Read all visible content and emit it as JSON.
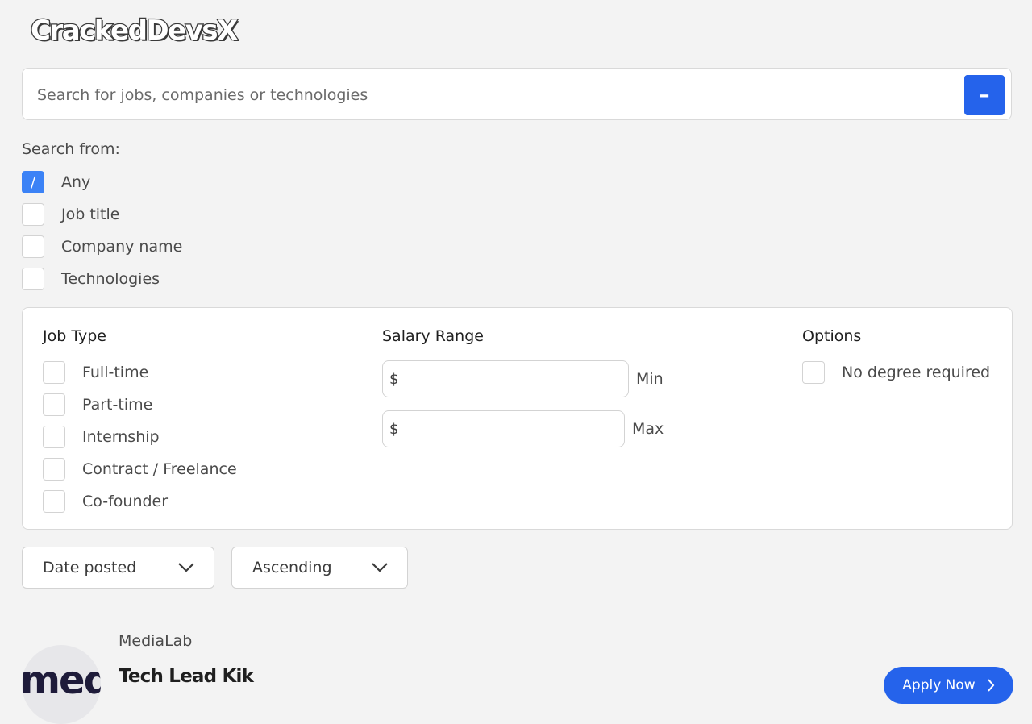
{
  "brand": {
    "logo_text": "CrackedDevsX"
  },
  "search": {
    "placeholder": "Search for jobs, companies or technologies",
    "value": "",
    "button_icon": "minus-icon"
  },
  "search_from": {
    "label": "Search from:",
    "options": [
      {
        "label": "Any",
        "checked": true
      },
      {
        "label": "Job title",
        "checked": false
      },
      {
        "label": "Company name",
        "checked": false
      },
      {
        "label": "Technologies",
        "checked": false
      }
    ]
  },
  "filters": {
    "job_type": {
      "heading": "Job Type",
      "options": [
        {
          "label": "Full-time",
          "checked": false
        },
        {
          "label": "Part-time",
          "checked": false
        },
        {
          "label": "Internship",
          "checked": false
        },
        {
          "label": "Contract / Freelance",
          "checked": false
        },
        {
          "label": "Co-founder",
          "checked": false
        }
      ]
    },
    "salary": {
      "heading": "Salary Range",
      "currency": "$",
      "min_label": "Min",
      "max_label": "Max",
      "min_value": "",
      "max_value": ""
    },
    "options": {
      "heading": "Options",
      "items": [
        {
          "label": "No degree required",
          "checked": false
        }
      ]
    }
  },
  "sort": {
    "field": "Date posted",
    "order": "Ascending"
  },
  "job": {
    "company": "MediaLab",
    "logo_text": "med",
    "title": "Tech Lead Kik",
    "apply_label": "Apply Now"
  },
  "colors": {
    "accent": "#2563eb",
    "checkbox_checked": "#3b82f6",
    "background": "#f3f3f3"
  }
}
